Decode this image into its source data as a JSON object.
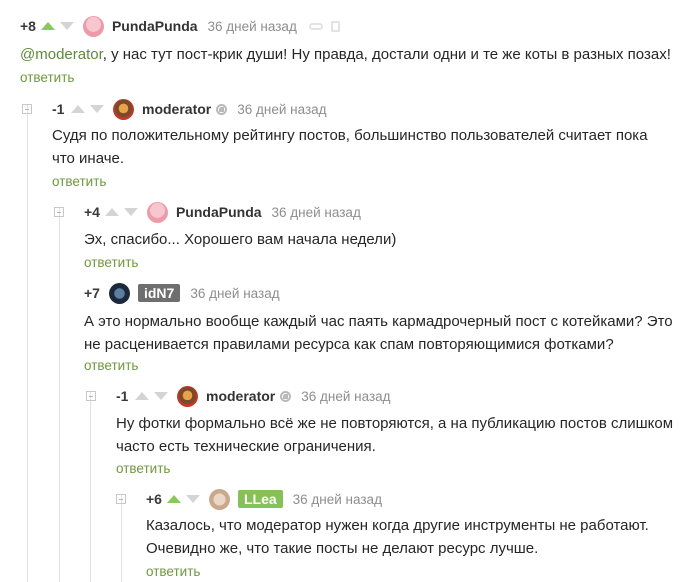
{
  "comments": [
    {
      "rating": "+8",
      "user": "PundaPunda",
      "time": "36 дней назад",
      "mention": "@moderator",
      "text": ", у нас тут пост-крик души! Ну правда, достали одни и те же коты в разных позах!",
      "reply": "ответить"
    },
    {
      "rating": "-1",
      "user": "moderator",
      "time": "36 дней назад",
      "text": "Судя по положительному рейтингу постов, большинство пользователей считает пока что иначе.",
      "reply": "ответить"
    },
    {
      "rating": "+4",
      "user": "PundaPunda",
      "time": "36 дней назад",
      "text": "Эх, спасибо... Хорошего вам начала недели)",
      "reply": "ответить"
    },
    {
      "rating": "+7",
      "user": "idN7",
      "time": "36 дней назад",
      "text": "А это нормально вообще каждый час паять кармадрочерный пост с котейками? Это не расценивается правилами ресурса как спам повторяющимися фотками?",
      "reply": "ответить"
    },
    {
      "rating": "-1",
      "user": "moderator",
      "time": "36 дней назад",
      "text": "Ну фотки формально всё же не повторяются, а  на публикацию  постов слишком часто есть технические ограничения.",
      "reply": "ответить"
    },
    {
      "rating": "+6",
      "user": "LLea",
      "time": "36 дней назад",
      "text": "Казалось, что  модератор нужен когда другие инструменты не работают. Очевидно же, что такие посты не делают ресурс лучше.",
      "reply": "ответить"
    }
  ],
  "colors": {
    "accent_green": "#8ac858",
    "link_green": "#6f9a3e",
    "idN7_badge": "#6e6e6e",
    "llea_badge": "#86c058"
  }
}
